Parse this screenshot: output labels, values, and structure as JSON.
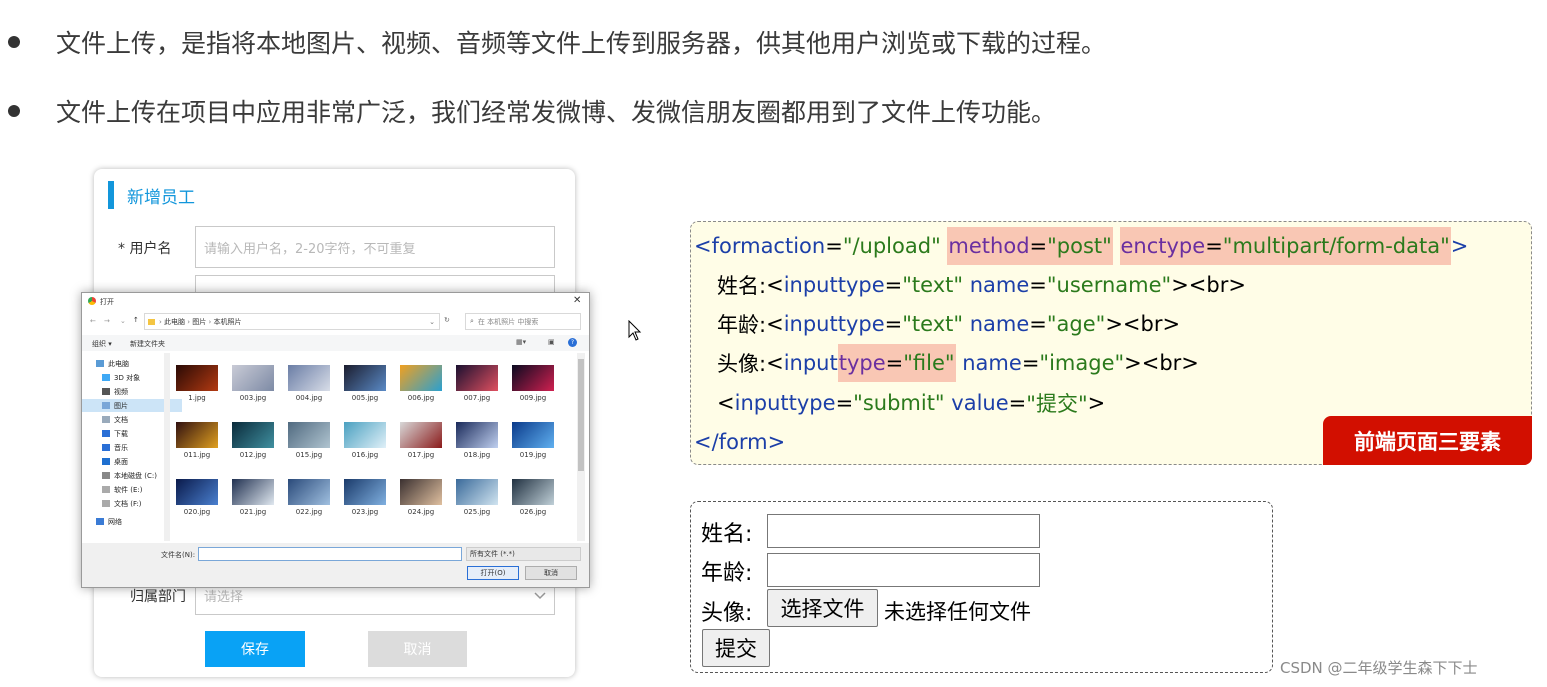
{
  "bullets": [
    "文件上传，是指将本地图片、视频、音频等文件上传到服务器，供其他用户浏览或下载的过程。",
    "文件上传在项目中应用非常广泛，我们经常发微博、发微信朋友圈都用到了文件上传功能。"
  ],
  "employee_form": {
    "title": "新增员工",
    "username_label": "* 用户名",
    "username_placeholder": "请输入用户名，2-20字符，不可重复",
    "department_label": "归属部门",
    "department_placeholder": "请选择",
    "save_label": "保存",
    "cancel_label": "取消"
  },
  "file_dialog": {
    "title": "打开",
    "breadcrumb": [
      "此电脑",
      "图片",
      "本机照片"
    ],
    "search_placeholder": "在 本机照片 中搜索",
    "organize": "组织 ▾",
    "new_folder": "新建文件夹",
    "nav_items": [
      "此电脑",
      "3D 对象",
      "视频",
      "图片",
      "文档",
      "下载",
      "音乐",
      "桌面",
      "本地磁盘 (C:)",
      "软件 (E:)",
      "文档 (F:)",
      "网络"
    ],
    "files": [
      "1.jpg",
      "003.jpg",
      "004.jpg",
      "005.jpg",
      "006.jpg",
      "007.jpg",
      "009.jpg",
      "011.jpg",
      "012.jpg",
      "015.jpg",
      "016.jpg",
      "017.jpg",
      "018.jpg",
      "019.jpg",
      "020.jpg",
      "021.jpg",
      "022.jpg",
      "023.jpg",
      "024.jpg",
      "025.jpg",
      "026.jpg"
    ],
    "filename_label": "文件名(N):",
    "filetype": "所有文件 (*.*)",
    "open_label": "打开(O)",
    "cancel_label": "取消"
  },
  "code": {
    "line1": {
      "open": "<form ",
      "action_attr": "action",
      "action_val": "\"/upload\"",
      "method_attr": "method",
      "method_val": "\"post\"",
      "enctype_attr": "enctype",
      "enctype_val": "\"multipart/form-data\"",
      "close": ">"
    },
    "line2": {
      "label": "姓名: ",
      "type_val": "\"text\"",
      "name_val": "\"username\""
    },
    "line3": {
      "label": "年龄: ",
      "type_val": "\"text\"",
      "name_val": "\"age\""
    },
    "line4": {
      "label": "头像: ",
      "type_val": "\"file\"",
      "name_val": "\"image\""
    },
    "line5": {
      "type_val": "\"submit\"",
      "value_attr": "value",
      "value_val": "\"提交\""
    },
    "line6": "</form>",
    "tokens": {
      "input_open": "<input ",
      "type_attr": "type",
      "name_attr": "name",
      "eq": "=",
      "br": "><br>",
      "gt": ">",
      "lt": "<",
      "input": "input "
    },
    "badge": "前端页面三要素"
  },
  "preview": {
    "name_label": "姓名:",
    "age_label": "年龄:",
    "avatar_label": "头像:",
    "choose_file": "选择文件",
    "no_file": "未选择任何文件",
    "submit": "提交"
  },
  "watermark": "CSDN @二年级学生森下下士",
  "colors": {
    "accent_blue": "#1296db",
    "save_blue": "#09a2f5",
    "badge_red": "#d20f00",
    "highlight": "#f9c7b4",
    "code_bg": "#fffde7"
  }
}
